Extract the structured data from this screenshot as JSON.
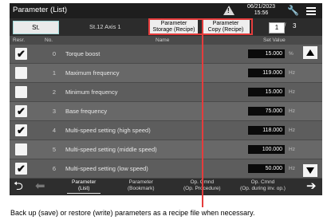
{
  "titlebar": {
    "title": "Parameter (List)",
    "date": "06/21/2023",
    "time": "15:56",
    "warning_glyph": "!"
  },
  "tabs": {
    "st_label": "St.",
    "station_axis": "St.12   Axis 1",
    "storage_line1": "Parameter",
    "storage_line2": "Storage (Recipe)",
    "copy_line1": "Parameter",
    "copy_line2": "Copy (Recipe)",
    "page_current": "1",
    "page_sep": "/",
    "page_total": "3"
  },
  "header": {
    "resr": "Resr.",
    "no": "No.",
    "name": "Name",
    "set_value": "Set Value"
  },
  "rows": [
    {
      "checked": true,
      "check": "✔",
      "no": "0",
      "name": "Torque boost",
      "value": "15.000",
      "unit": "%"
    },
    {
      "checked": false,
      "check": "",
      "no": "1",
      "name": "Maximum frequency",
      "value": "119.000",
      "unit": "Hz"
    },
    {
      "checked": false,
      "check": "",
      "no": "2",
      "name": "Minimum frequency",
      "value": "15.000",
      "unit": "Hz"
    },
    {
      "checked": true,
      "check": "✔",
      "no": "3",
      "name": "Base frequency",
      "value": "75.000",
      "unit": "Hz"
    },
    {
      "checked": true,
      "check": "✔",
      "no": "4",
      "name": "Multi-speed setting (high speed)",
      "value": "118.000",
      "unit": "Hz"
    },
    {
      "checked": false,
      "check": "",
      "no": "5",
      "name": "Multi-speed setting (middle speed)",
      "value": "100.000",
      "unit": "Hz"
    },
    {
      "checked": true,
      "check": "✔",
      "no": "6",
      "name": "Multi-speed setting (low speed)",
      "value": "50.000",
      "unit": "Hz"
    }
  ],
  "bottom": {
    "nav1_l1": "Parameter",
    "nav1_l2": "(List)",
    "nav2_l1": "Parameter",
    "nav2_l2": "(Bookmark)",
    "nav3_l1": "Op. Cmnd",
    "nav3_l2": "(Op. Procedure)",
    "nav4_l1": "Op. Cmnd",
    "nav4_l2": "(Op. during inv. op.)"
  },
  "caption": "Back up (save) or restore (write) parameters as a recipe file when necessary.",
  "icons": [
    "warning-icon",
    "wrench-icon",
    "menu-icon",
    "scroll-up-icon",
    "scroll-down-icon",
    "return-icon",
    "back-arrow-icon",
    "forward-arrow-icon",
    "checkbox-checked-icon"
  ],
  "colors": {
    "callout": "#e53c3c",
    "screen_bg": "#4a4a4a",
    "titlebar_bg": "#1e1e1e"
  }
}
